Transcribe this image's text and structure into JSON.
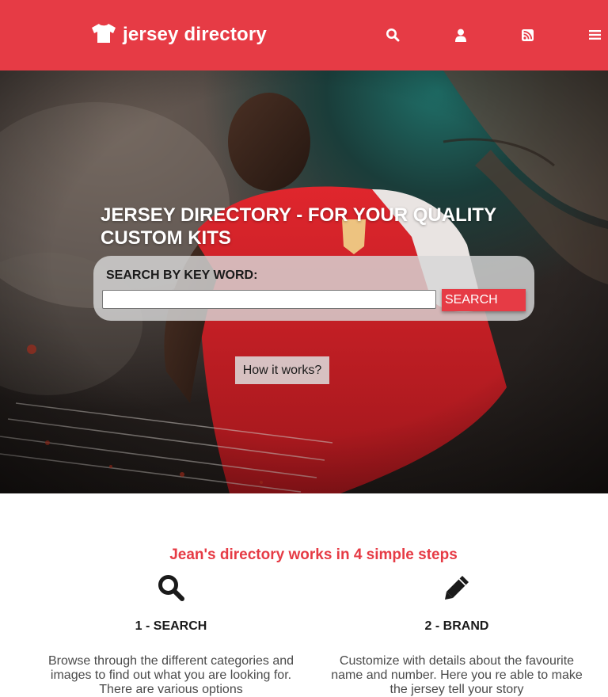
{
  "header": {
    "logo_text": "jersey directory",
    "icons": [
      "tshirt-icon",
      "search-icon",
      "user-icon",
      "rss-icon",
      "menu-icon"
    ]
  },
  "hero": {
    "title": "JERSEY DIRECTORY - FOR YOUR QUALITY CUSTOM KITS",
    "search_label": "SEARCH BY KEY WORD:",
    "search_value": "",
    "search_button": "SEARCH",
    "how_button": "How it works?"
  },
  "steps": {
    "heading": "Jean's directory works in 4 simple steps",
    "items": [
      {
        "icon": "search-icon",
        "title": "1 - SEARCH",
        "desc": "Browse through the different categories and images to find out what you are looking for. There are various options"
      },
      {
        "icon": "pencil-icon",
        "title": "2 - BRAND",
        "desc": "Customize with details about the favourite name and number. Here you re able to make the jersey tell your story"
      }
    ]
  },
  "colors": {
    "brand": "#e63b45",
    "header_text": "#ffffff",
    "body_text": "#4a4a4a"
  }
}
